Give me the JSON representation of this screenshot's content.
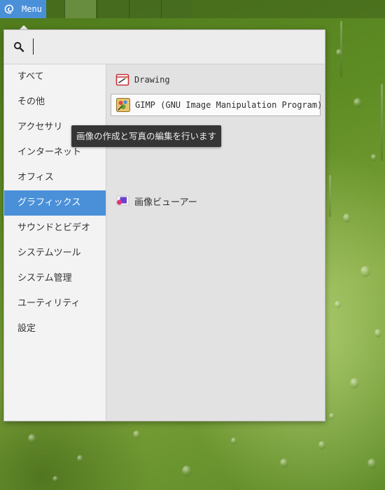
{
  "panel": {
    "menu_label": "Menu",
    "menu_icon": "debian-swirl-icon",
    "workspaces": 5,
    "active_workspace": 1
  },
  "search": {
    "icon": "search-icon",
    "value": "",
    "placeholder": ""
  },
  "categories": [
    "すべて",
    "その他",
    "アクセサリ",
    "インターネット",
    "オフィス",
    "グラフィックス",
    "サウンドとビデオ",
    "システムツール",
    "システム管理",
    "ユーティリティ",
    "設定"
  ],
  "selected_category": "グラフィックス",
  "apps": [
    {
      "label": "Drawing",
      "icon": "drawing-app-icon"
    },
    {
      "label": "GIMP (GNU Image Manipulation Program)",
      "icon": "gimp-app-icon"
    },
    {
      "label": "画像ビューアー",
      "icon": "image-viewer-app-icon"
    }
  ],
  "tooltip": "画像の作成と写真の編集を行います",
  "colors": {
    "accent": "#4a90d9",
    "tooltip_bg": "#353535"
  }
}
